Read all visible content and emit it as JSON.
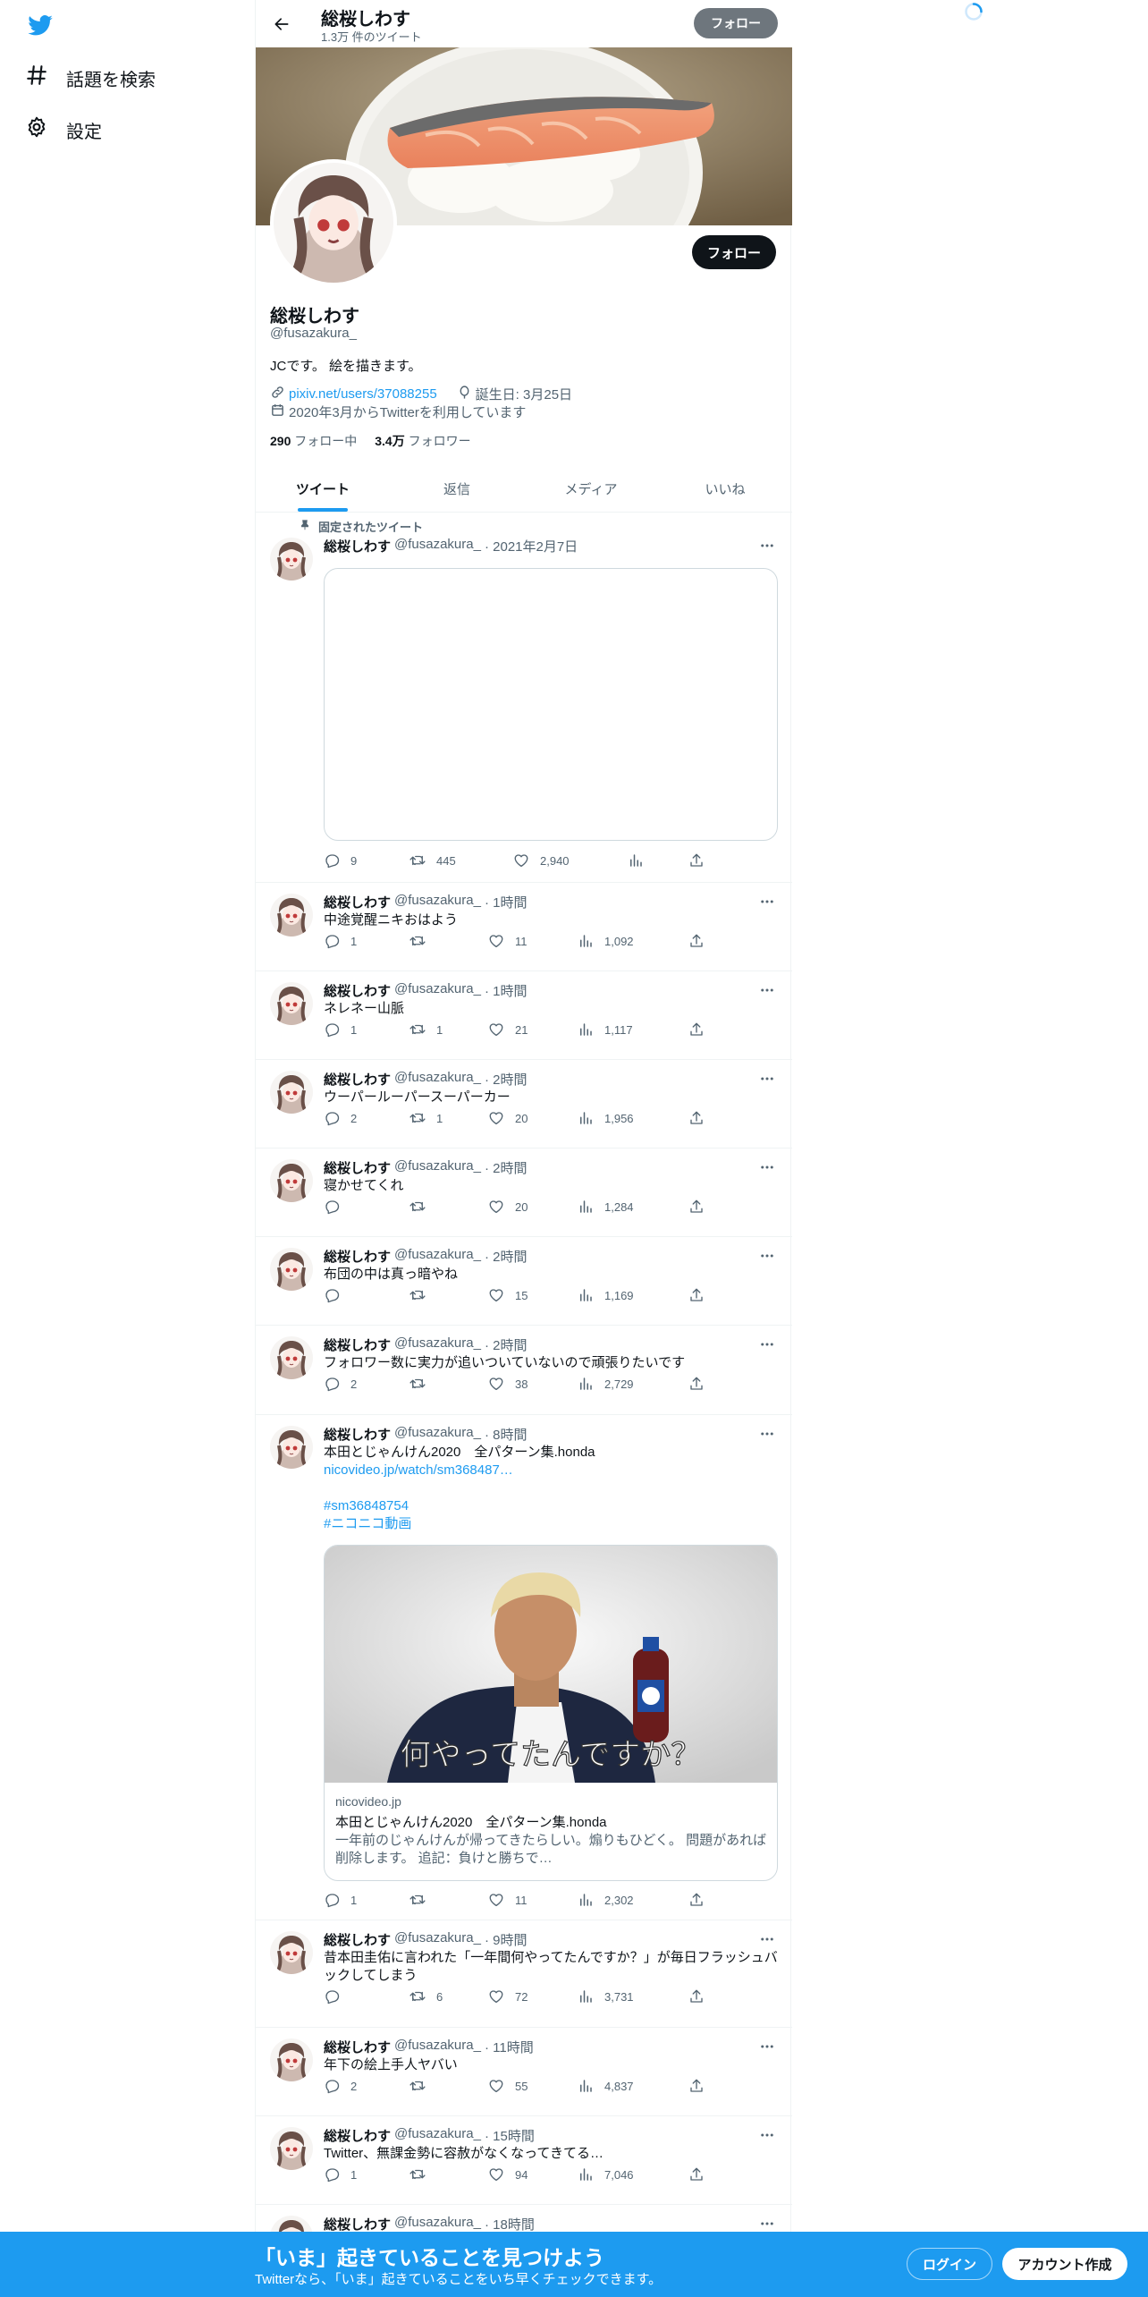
{
  "nav": {
    "explore_label": "話題を検索",
    "settings_label": "設定"
  },
  "header": {
    "name": "総桜しわす",
    "tweet_count": "1.3万 件のツイート",
    "follow_label": "フォロー"
  },
  "profile": {
    "name": "総桜しわす",
    "handle": "@fusazakura_",
    "bio": "JCです。 絵を描きます。",
    "url": "pixiv.net/users/37088255",
    "birthday": "誕生日: 3月25日",
    "joined": "2020年3月からTwitterを利用しています",
    "following_count": "290",
    "following_label": "フォロー中",
    "followers_count": "3.4万",
    "followers_label": "フォロワー",
    "follow_label": "フォロー"
  },
  "tabs": [
    "ツイート",
    "返信",
    "メディア",
    "いいね"
  ],
  "pinned_label": "固定されたツイート",
  "tweets": [
    {
      "name": "総桜しわす",
      "handle": "@fusazakura_",
      "time": "· 2021年2月7日",
      "text": "",
      "reply": "9",
      "retweet": "445",
      "like": "2,940",
      "views": ""
    },
    {
      "name": "総桜しわす",
      "handle": "@fusazakura_",
      "time": "· 1時間",
      "text": "中途覚醒ニキおはよう",
      "reply": "1",
      "retweet": "",
      "like": "11",
      "views": "1,092"
    },
    {
      "name": "総桜しわす",
      "handle": "@fusazakura_",
      "time": "· 1時間",
      "text": "ネレネー山脈",
      "reply": "1",
      "retweet": "1",
      "like": "21",
      "views": "1,117"
    },
    {
      "name": "総桜しわす",
      "handle": "@fusazakura_",
      "time": "· 2時間",
      "text": "ウーパールーパースーパーカー",
      "reply": "2",
      "retweet": "1",
      "like": "20",
      "views": "1,956"
    },
    {
      "name": "総桜しわす",
      "handle": "@fusazakura_",
      "time": "· 2時間",
      "text": "寝かせてくれ",
      "reply": "",
      "retweet": "",
      "like": "20",
      "views": "1,284"
    },
    {
      "name": "総桜しわす",
      "handle": "@fusazakura_",
      "time": "· 2時間",
      "text": "布団の中は真っ暗やね",
      "reply": "",
      "retweet": "",
      "like": "15",
      "views": "1,169"
    },
    {
      "name": "総桜しわす",
      "handle": "@fusazakura_",
      "time": "· 2時間",
      "text": "フォロワー数に実力が追いついていないので頑張りたいです",
      "reply": "2",
      "retweet": "",
      "like": "38",
      "views": "2,729"
    },
    {
      "name": "総桜しわす",
      "handle": "@fusazakura_",
      "time": "· 8時間",
      "text": "本田とじゃんけん2020　全パターン集.honda",
      "link": "nicovideo.jp/watch/sm368487…",
      "tag1": "#sm36848754",
      "tag2": "#ニコニコ動画",
      "reply": "1",
      "retweet": "",
      "like": "11",
      "views": "2,302"
    },
    {
      "name": "総桜しわす",
      "handle": "@fusazakura_",
      "time": "· 9時間",
      "text": "昔本田圭佑に言われた「一年間何やってたんですか？」が毎日フラッシュバックしてしまう",
      "reply": "",
      "retweet": "6",
      "like": "72",
      "views": "3,731"
    },
    {
      "name": "総桜しわす",
      "handle": "@fusazakura_",
      "time": "· 11時間",
      "text": "年下の絵上手人ヤバい",
      "reply": "2",
      "retweet": "",
      "like": "55",
      "views": "4,837"
    },
    {
      "name": "総桜しわす",
      "handle": "@fusazakura_",
      "time": "· 15時間",
      "text": "Twitter、無課金勢に容赦がなくなってきてる…",
      "reply": "1",
      "retweet": "",
      "like": "94",
      "views": "7,046"
    },
    {
      "name": "総桜しわす",
      "handle": "@fusazakura_",
      "time": "· 18時間",
      "text": "",
      "reply": "",
      "retweet": "",
      "like": "",
      "views": ""
    }
  ],
  "card": {
    "caption": "何やってたんですか？",
    "domain": "nicovideo.jp",
    "title": "本田とじゃんけん2020　全パターン集.honda",
    "desc": "一年前のじゃんけんが帰ってきたらしい。煽りもひどく。 問題があれば削除します。 追記：負けと勝ちで…"
  },
  "bottom": {
    "title": "「いま」起きていることを見つけよう",
    "subtitle": "Twitterなら、「いま」起きていることをいち早くチェックできます。",
    "login": "ログイン",
    "signup": "アカウント作成"
  },
  "colors": {
    "accent": "#1d9bf0",
    "text": "#0f1419",
    "muted": "#536471"
  }
}
